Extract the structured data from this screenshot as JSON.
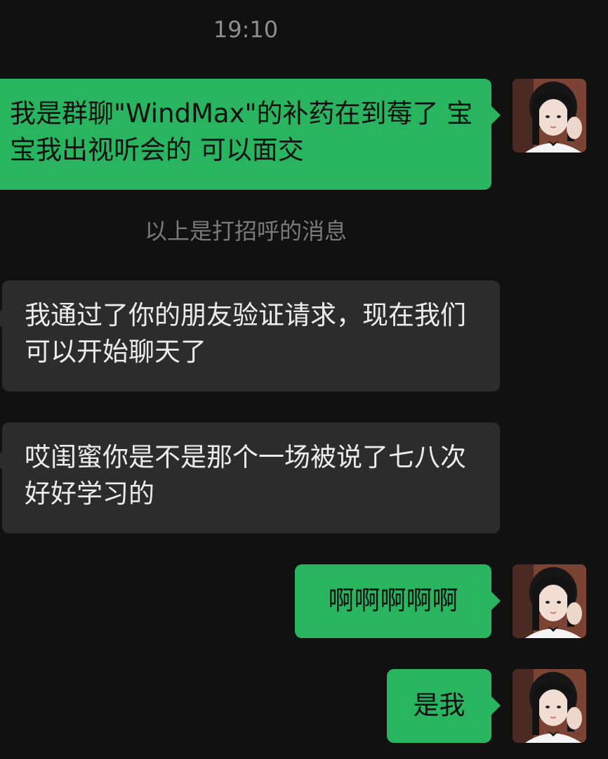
{
  "chat": {
    "timestamp": "19:10",
    "system_note": "以上是打招呼的消息",
    "messages": [
      {
        "direction": "outgoing",
        "text": "我是群聊\"WindMax\"的补药在到莓了 宝宝我出视听会的 可以面交"
      },
      {
        "direction": "incoming",
        "text": "我通过了你的朋友验证请求，现在我们可以开始聊天了"
      },
      {
        "direction": "incoming",
        "text": "哎闺蜜你是不是那个一场被说了七八次好好学习的"
      },
      {
        "direction": "outgoing",
        "text": "啊啊啊啊啊"
      },
      {
        "direction": "outgoing",
        "text": "是我"
      }
    ]
  },
  "colors": {
    "background": "#111111",
    "outgoing_bubble": "#29b560",
    "incoming_bubble": "#2c2c2c",
    "timestamp_text": "#8e8e8e"
  },
  "icons": {
    "avatar": "user-avatar-photo"
  }
}
